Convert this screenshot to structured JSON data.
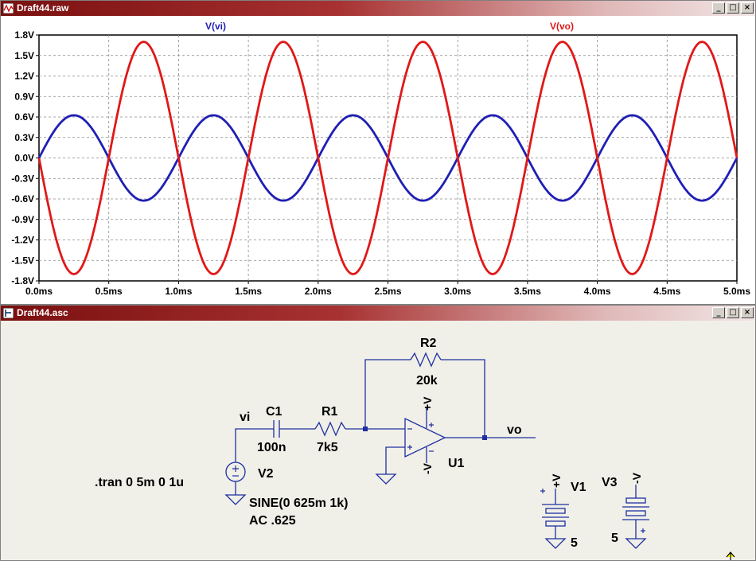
{
  "plot_window": {
    "title": "Draft44.raw",
    "buttons": [
      "_",
      "□",
      "×"
    ]
  },
  "schematic_window": {
    "title": "Draft44.asc",
    "buttons": [
      "_",
      "□",
      "×"
    ]
  },
  "chart_data": {
    "type": "line",
    "series": [
      {
        "name": "V(vi)",
        "color": "#1f1fb4",
        "amplitude": 0.625,
        "frequency_khz": 1,
        "phase": "sin"
      },
      {
        "name": "V(vo)",
        "color": "#e01818",
        "amplitude": 1.7,
        "frequency_khz": 1,
        "phase": "-sin"
      }
    ],
    "x_ticks": [
      "0.0ms",
      "0.5ms",
      "1.0ms",
      "1.5ms",
      "2.0ms",
      "2.5ms",
      "3.0ms",
      "3.5ms",
      "4.0ms",
      "4.5ms",
      "5.0ms"
    ],
    "y_ticks": [
      "1.8V",
      "1.5V",
      "1.2V",
      "0.9V",
      "0.6V",
      "0.3V",
      "0.0V",
      "-0.3V",
      "-0.6V",
      "-0.9V",
      "-1.2V",
      "-1.5V",
      "-1.8V"
    ],
    "xlim": [
      0,
      5
    ],
    "ylim": [
      -1.8,
      1.8
    ],
    "grid": true
  },
  "schematic": {
    "net_vi": "vi",
    "net_vo": "vo",
    "c1_name": "C1",
    "c1_value": "100n",
    "r1_name": "R1",
    "r1_value": "7k5",
    "r2_name": "R2",
    "r2_value": "20k",
    "u1_name": "U1",
    "v2_name": "V2",
    "v2_spec1": "SINE(0 625m 1k)",
    "v2_spec2": "AC .625",
    "tran": ".tran 0 5m 0 1u",
    "v1_name": "V1",
    "v1_value": "5",
    "v3_name": "V3",
    "v3_value": "5",
    "vplus": "+V",
    "vminus": "-V"
  }
}
